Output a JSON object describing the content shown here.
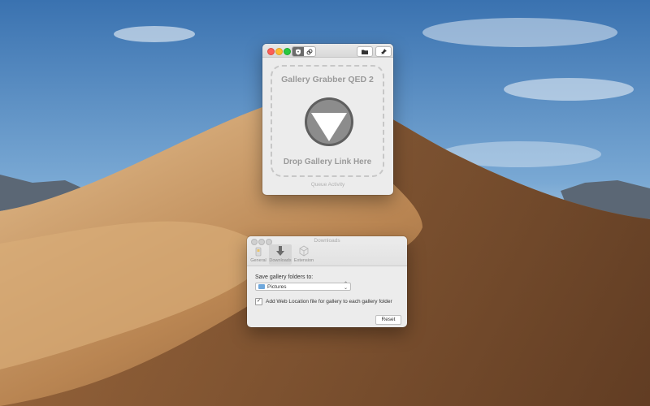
{
  "desktop": {
    "wallpaper": "desert-dunes"
  },
  "gallery_window": {
    "title": "Gallery Grabber QED 2",
    "drop_text": "Drop Gallery Link Here",
    "queue_link": "Queue Activity",
    "drop_icon": "down-triangle-icon",
    "toolbar": {
      "segment_icons": [
        "shield-icon",
        "link-icon"
      ],
      "folder_icon": "folder-icon",
      "pin_icon": "pin-icon"
    }
  },
  "downloads_window": {
    "title": "Downloads",
    "tabs": [
      {
        "label": "General",
        "icon": "general-icon",
        "active": false
      },
      {
        "label": "Downloads",
        "icon": "download-arrow-icon",
        "active": true
      },
      {
        "label": "Extension",
        "icon": "extension-icon",
        "active": false
      }
    ],
    "save_label": "Save gallery folders to:",
    "folder_value": "Pictures",
    "checkbox_checked": true,
    "checkbox_label": "Add Web Location file for gallery to each gallery folder",
    "reset_label": "Reset"
  },
  "colors": {
    "close": "#fc5f57",
    "minimize": "#fdbc2e",
    "zoom": "#29c840",
    "drop_circle": "#8c8c8c"
  }
}
